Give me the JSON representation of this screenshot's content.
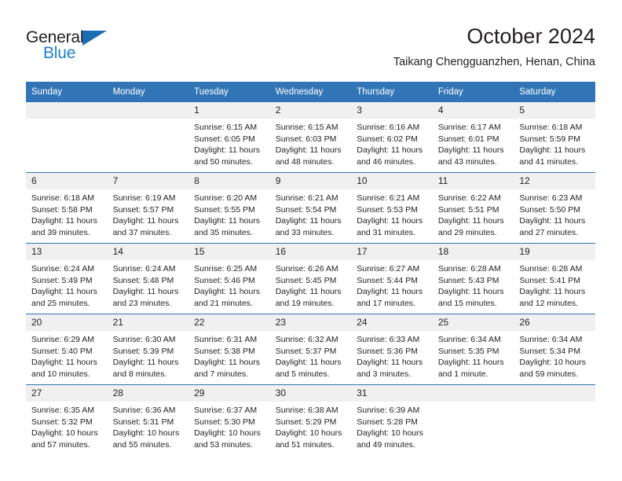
{
  "brand": {
    "name_part1": "General",
    "name_part2": "Blue",
    "triangle_color": "#1b6cb3",
    "blue_color": "#1f7fd0"
  },
  "header": {
    "title": "October 2024",
    "location": "Taikang Chengguanzhen, Henan, China"
  },
  "theme": {
    "header_bg": "#3275b6",
    "daynum_bg": "#f0f0f0",
    "text": "#231f20"
  },
  "calendar": {
    "weekday_headers": [
      "Sunday",
      "Monday",
      "Tuesday",
      "Wednesday",
      "Thursday",
      "Friday",
      "Saturday"
    ],
    "weeks": [
      [
        {
          "day": "",
          "lines": []
        },
        {
          "day": "",
          "lines": []
        },
        {
          "day": "1",
          "lines": [
            "Sunrise: 6:15 AM",
            "Sunset: 6:05 PM",
            "Daylight: 11 hours",
            "and 50 minutes."
          ]
        },
        {
          "day": "2",
          "lines": [
            "Sunrise: 6:15 AM",
            "Sunset: 6:03 PM",
            "Daylight: 11 hours",
            "and 48 minutes."
          ]
        },
        {
          "day": "3",
          "lines": [
            "Sunrise: 6:16 AM",
            "Sunset: 6:02 PM",
            "Daylight: 11 hours",
            "and 46 minutes."
          ]
        },
        {
          "day": "4",
          "lines": [
            "Sunrise: 6:17 AM",
            "Sunset: 6:01 PM",
            "Daylight: 11 hours",
            "and 43 minutes."
          ]
        },
        {
          "day": "5",
          "lines": [
            "Sunrise: 6:18 AM",
            "Sunset: 5:59 PM",
            "Daylight: 11 hours",
            "and 41 minutes."
          ]
        }
      ],
      [
        {
          "day": "6",
          "lines": [
            "Sunrise: 6:18 AM",
            "Sunset: 5:58 PM",
            "Daylight: 11 hours",
            "and 39 minutes."
          ]
        },
        {
          "day": "7",
          "lines": [
            "Sunrise: 6:19 AM",
            "Sunset: 5:57 PM",
            "Daylight: 11 hours",
            "and 37 minutes."
          ]
        },
        {
          "day": "8",
          "lines": [
            "Sunrise: 6:20 AM",
            "Sunset: 5:55 PM",
            "Daylight: 11 hours",
            "and 35 minutes."
          ]
        },
        {
          "day": "9",
          "lines": [
            "Sunrise: 6:21 AM",
            "Sunset: 5:54 PM",
            "Daylight: 11 hours",
            "and 33 minutes."
          ]
        },
        {
          "day": "10",
          "lines": [
            "Sunrise: 6:21 AM",
            "Sunset: 5:53 PM",
            "Daylight: 11 hours",
            "and 31 minutes."
          ]
        },
        {
          "day": "11",
          "lines": [
            "Sunrise: 6:22 AM",
            "Sunset: 5:51 PM",
            "Daylight: 11 hours",
            "and 29 minutes."
          ]
        },
        {
          "day": "12",
          "lines": [
            "Sunrise: 6:23 AM",
            "Sunset: 5:50 PM",
            "Daylight: 11 hours",
            "and 27 minutes."
          ]
        }
      ],
      [
        {
          "day": "13",
          "lines": [
            "Sunrise: 6:24 AM",
            "Sunset: 5:49 PM",
            "Daylight: 11 hours",
            "and 25 minutes."
          ]
        },
        {
          "day": "14",
          "lines": [
            "Sunrise: 6:24 AM",
            "Sunset: 5:48 PM",
            "Daylight: 11 hours",
            "and 23 minutes."
          ]
        },
        {
          "day": "15",
          "lines": [
            "Sunrise: 6:25 AM",
            "Sunset: 5:46 PM",
            "Daylight: 11 hours",
            "and 21 minutes."
          ]
        },
        {
          "day": "16",
          "lines": [
            "Sunrise: 6:26 AM",
            "Sunset: 5:45 PM",
            "Daylight: 11 hours",
            "and 19 minutes."
          ]
        },
        {
          "day": "17",
          "lines": [
            "Sunrise: 6:27 AM",
            "Sunset: 5:44 PM",
            "Daylight: 11 hours",
            "and 17 minutes."
          ]
        },
        {
          "day": "18",
          "lines": [
            "Sunrise: 6:28 AM",
            "Sunset: 5:43 PM",
            "Daylight: 11 hours",
            "and 15 minutes."
          ]
        },
        {
          "day": "19",
          "lines": [
            "Sunrise: 6:28 AM",
            "Sunset: 5:41 PM",
            "Daylight: 11 hours",
            "and 12 minutes."
          ]
        }
      ],
      [
        {
          "day": "20",
          "lines": [
            "Sunrise: 6:29 AM",
            "Sunset: 5:40 PM",
            "Daylight: 11 hours",
            "and 10 minutes."
          ]
        },
        {
          "day": "21",
          "lines": [
            "Sunrise: 6:30 AM",
            "Sunset: 5:39 PM",
            "Daylight: 11 hours",
            "and 8 minutes."
          ]
        },
        {
          "day": "22",
          "lines": [
            "Sunrise: 6:31 AM",
            "Sunset: 5:38 PM",
            "Daylight: 11 hours",
            "and 7 minutes."
          ]
        },
        {
          "day": "23",
          "lines": [
            "Sunrise: 6:32 AM",
            "Sunset: 5:37 PM",
            "Daylight: 11 hours",
            "and 5 minutes."
          ]
        },
        {
          "day": "24",
          "lines": [
            "Sunrise: 6:33 AM",
            "Sunset: 5:36 PM",
            "Daylight: 11 hours",
            "and 3 minutes."
          ]
        },
        {
          "day": "25",
          "lines": [
            "Sunrise: 6:34 AM",
            "Sunset: 5:35 PM",
            "Daylight: 11 hours",
            "and 1 minute."
          ]
        },
        {
          "day": "26",
          "lines": [
            "Sunrise: 6:34 AM",
            "Sunset: 5:34 PM",
            "Daylight: 10 hours",
            "and 59 minutes."
          ]
        }
      ],
      [
        {
          "day": "27",
          "lines": [
            "Sunrise: 6:35 AM",
            "Sunset: 5:32 PM",
            "Daylight: 10 hours",
            "and 57 minutes."
          ]
        },
        {
          "day": "28",
          "lines": [
            "Sunrise: 6:36 AM",
            "Sunset: 5:31 PM",
            "Daylight: 10 hours",
            "and 55 minutes."
          ]
        },
        {
          "day": "29",
          "lines": [
            "Sunrise: 6:37 AM",
            "Sunset: 5:30 PM",
            "Daylight: 10 hours",
            "and 53 minutes."
          ]
        },
        {
          "day": "30",
          "lines": [
            "Sunrise: 6:38 AM",
            "Sunset: 5:29 PM",
            "Daylight: 10 hours",
            "and 51 minutes."
          ]
        },
        {
          "day": "31",
          "lines": [
            "Sunrise: 6:39 AM",
            "Sunset: 5:28 PM",
            "Daylight: 10 hours",
            "and 49 minutes."
          ]
        },
        {
          "day": "",
          "lines": []
        },
        {
          "day": "",
          "lines": []
        }
      ]
    ]
  }
}
